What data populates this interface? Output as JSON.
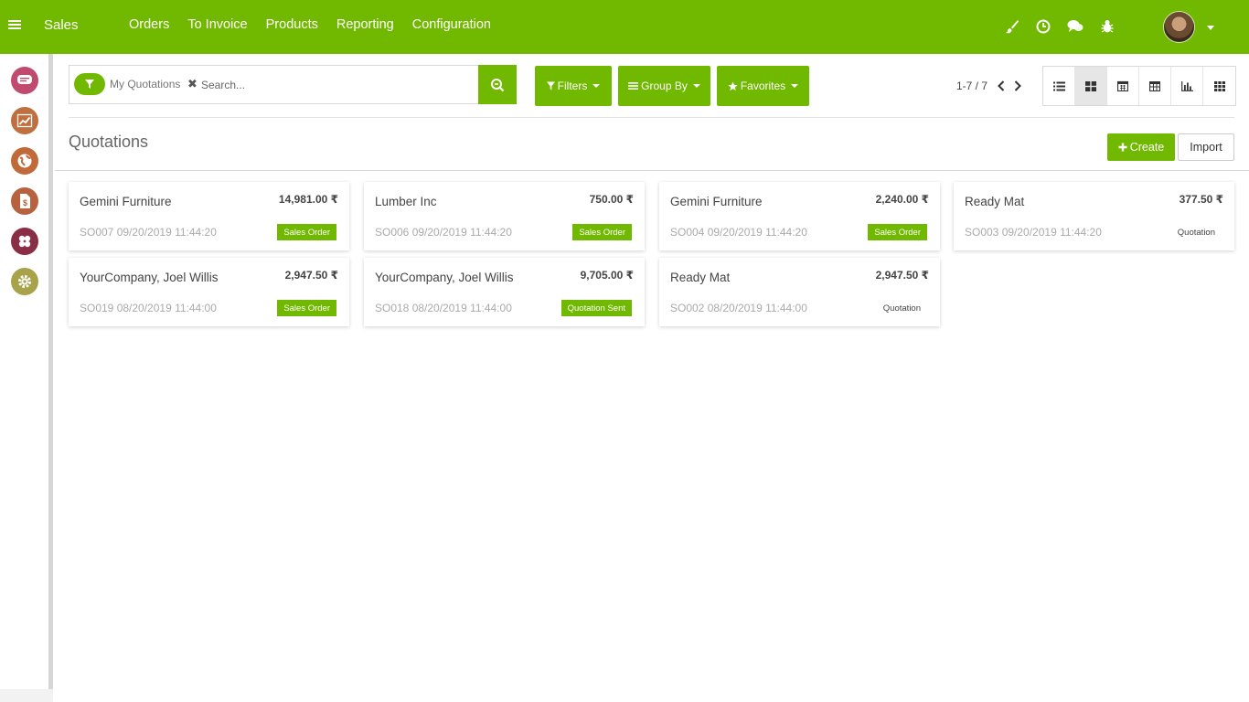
{
  "navbar": {
    "brand": "Sales",
    "menu": [
      "Orders",
      "To Invoice",
      "Products",
      "Reporting",
      "Configuration"
    ],
    "icons": [
      "brush-icon",
      "clock-icon",
      "chat-icon",
      "bug-icon"
    ]
  },
  "sidebar": {
    "apps": [
      {
        "name": "discuss-app-icon",
        "color": "#c04b6e"
      },
      {
        "name": "sales-app-icon",
        "color": "#c0703f"
      },
      {
        "name": "website-app-icon",
        "color": "#c06a3a"
      },
      {
        "name": "invoicing-app-icon",
        "color": "#b8613f"
      },
      {
        "name": "apps-app-icon",
        "color": "#8a2e45"
      },
      {
        "name": "settings-app-icon",
        "color": "#a8a24a"
      }
    ]
  },
  "search": {
    "facet": "My Quotations",
    "placeholder": "Search..."
  },
  "controls": {
    "filters": "Filters",
    "group_by": "Group By",
    "favorites": "Favorites"
  },
  "pager": {
    "text": "1-7 / 7"
  },
  "views": [
    "list",
    "kanban",
    "calendar",
    "pivot",
    "graph",
    "grid"
  ],
  "active_view": "kanban",
  "page": {
    "title": "Quotations",
    "create": "Create",
    "import": "Import"
  },
  "cards": [
    {
      "customer": "Gemini Furniture",
      "amount": "14,981.00 ₹",
      "ref": "SO007 09/20/2019 11:44:20",
      "status": "Sales Order",
      "badge": true
    },
    {
      "customer": "Lumber Inc",
      "amount": "750.00 ₹",
      "ref": "SO006 09/20/2019 11:44:20",
      "status": "Sales Order",
      "badge": true
    },
    {
      "customer": "Gemini Furniture",
      "amount": "2,240.00 ₹",
      "ref": "SO004 09/20/2019 11:44:20",
      "status": "Sales Order",
      "badge": true
    },
    {
      "customer": "Ready Mat",
      "amount": "377.50 ₹",
      "ref": "SO003 09/20/2019 11:44:20",
      "status": "Quotation",
      "badge": false
    },
    {
      "customer": "YourCompany, Joel Willis",
      "amount": "2,947.50 ₹",
      "ref": "SO019 08/20/2019 11:44:00",
      "status": "Sales Order",
      "badge": true
    },
    {
      "customer": "YourCompany, Joel Willis",
      "amount": "9,705.00 ₹",
      "ref": "SO018 08/20/2019 11:44:00",
      "status": "Quotation Sent",
      "badge": true
    },
    {
      "customer": "Ready Mat",
      "amount": "2,947.50 ₹",
      "ref": "SO002 08/20/2019 11:44:00",
      "status": "Quotation",
      "badge": false
    }
  ],
  "colors": {
    "primary": "#71b800"
  }
}
